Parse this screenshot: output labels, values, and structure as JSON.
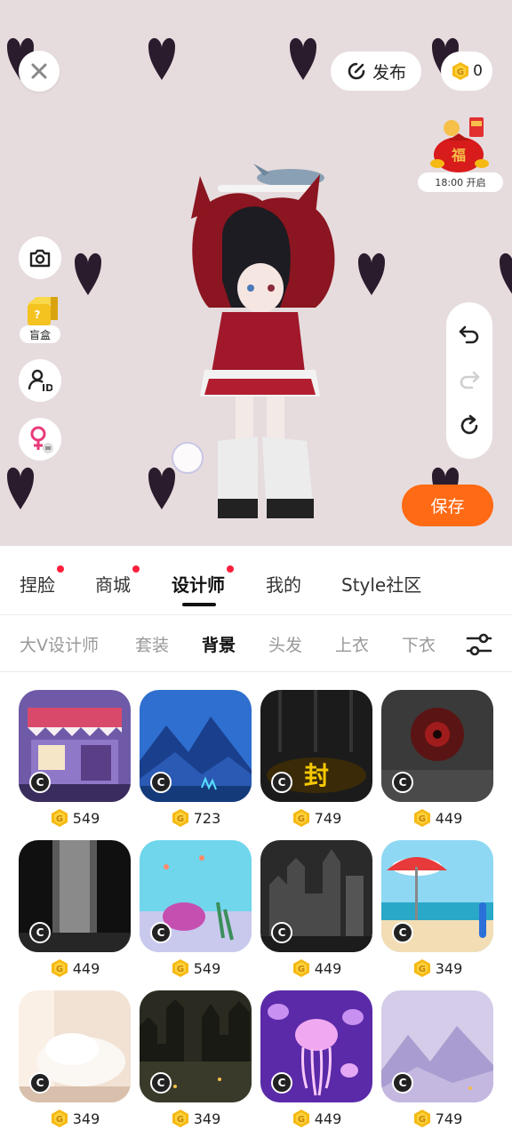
{
  "header": {
    "publish_label": "发布",
    "coin_balance": "0",
    "event_time": "18:00 开启"
  },
  "left_tools": {
    "blindbox_label": "盲盒"
  },
  "save_label": "保存",
  "main_tabs": [
    {
      "label": "捏脸",
      "dot": true
    },
    {
      "label": "商城",
      "dot": true
    },
    {
      "label": "设计师",
      "dot": true,
      "active": true
    },
    {
      "label": "我的",
      "dot": false
    },
    {
      "label": "Style社区",
      "dot": false
    }
  ],
  "sub_tabs": [
    {
      "label": "大V设计师"
    },
    {
      "label": "套装"
    },
    {
      "label": "背景",
      "active": true
    },
    {
      "label": "头发"
    },
    {
      "label": "上衣"
    },
    {
      "label": "下衣"
    }
  ],
  "items": [
    {
      "price": "549",
      "theme": "shop"
    },
    {
      "price": "723",
      "theme": "mountains"
    },
    {
      "price": "749",
      "theme": "dark-stage"
    },
    {
      "price": "449",
      "theme": "red-eye"
    },
    {
      "price": "449",
      "theme": "mist-pillar"
    },
    {
      "price": "549",
      "theme": "underwater"
    },
    {
      "price": "449",
      "theme": "gray-castle"
    },
    {
      "price": "349",
      "theme": "beach"
    },
    {
      "price": "349",
      "theme": "cream-room"
    },
    {
      "price": "349",
      "theme": "night-city"
    },
    {
      "price": "449",
      "theme": "jellyfish"
    },
    {
      "price": "749",
      "theme": "lavender-peaks"
    }
  ],
  "colors": {
    "accent": "#ff6a14",
    "stage_bg": "#e6dcde",
    "dot": "#ff1f3c",
    "coin": "#f6b913"
  }
}
